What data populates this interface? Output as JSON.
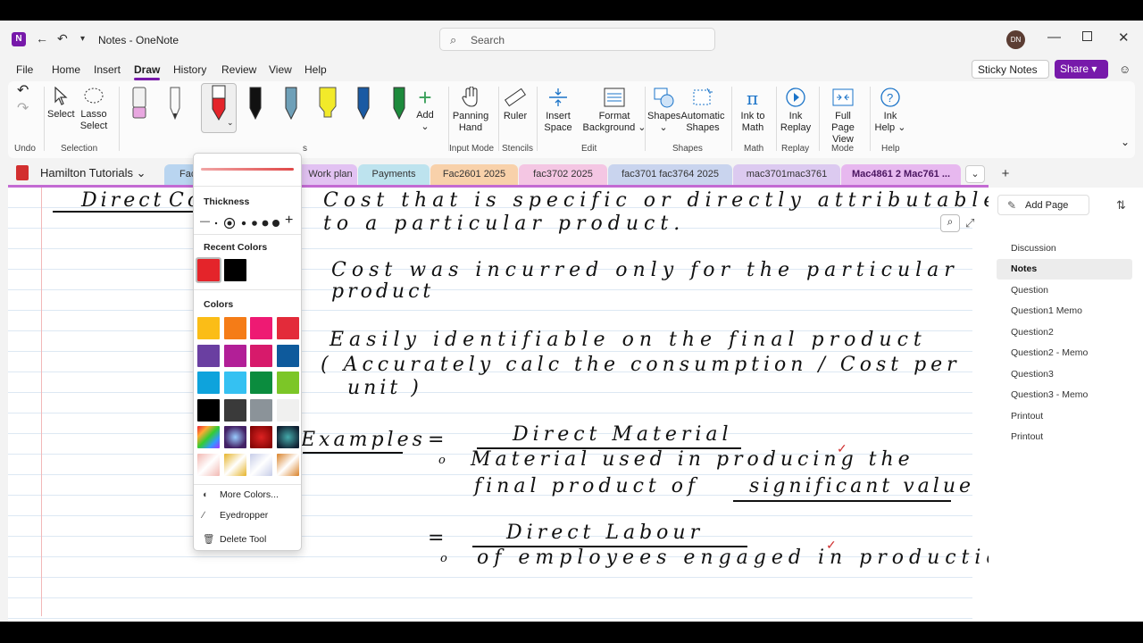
{
  "window": {
    "title": "Notes  -  OneNote",
    "avatar": "DN"
  },
  "search": {
    "placeholder": "Search"
  },
  "menu": {
    "items": [
      "File",
      "Home",
      "Insert",
      "Draw",
      "History",
      "Review",
      "View",
      "Help"
    ],
    "active": "Draw"
  },
  "header_buttons": {
    "sticky_notes": "Sticky Notes",
    "share": "Share"
  },
  "ribbon": {
    "groups": {
      "undo": "Undo",
      "selection": "Selection",
      "input_mode": "Input Mode",
      "stencils": "Stencils",
      "edit": "Edit",
      "shapes": "Shapes",
      "math": "Math",
      "replay": "Replay",
      "mode": "Mode",
      "help": "Help"
    },
    "select": "Select",
    "lasso_1": "Lasso",
    "lasso_2": "Select",
    "add": "Add",
    "panning_1": "Panning",
    "panning_2": "Hand",
    "ruler": "Ruler",
    "insert_space_1": "Insert",
    "insert_space_2": "Space",
    "format_bg_1": "Format",
    "format_bg_2": "Background",
    "shapes": "Shapes",
    "auto_shapes_1": "Automatic",
    "auto_shapes_2": "Shapes",
    "ink_math_1": "Ink to",
    "ink_math_2": "Math",
    "ink_replay_1": "Ink",
    "ink_replay_2": "Replay",
    "full_page_1": "Full Page",
    "full_page_2": "View",
    "ink_help_1": "Ink",
    "ink_help_2": "Help",
    "partial_label": "s"
  },
  "notebook": {
    "name": "Hamilton Tutorials"
  },
  "sections": [
    {
      "label": "Fac",
      "color": "#b9d5f0"
    },
    {
      "label": "Work plan",
      "color": "#e2c2f2"
    },
    {
      "label": "Payments",
      "color": "#bde3ee"
    },
    {
      "label": "Fac2601 2025",
      "color": "#f8d1aa"
    },
    {
      "label": "fac3702 2025",
      "color": "#f4c6e3"
    },
    {
      "label": "fac3701 fac3764 2025",
      "color": "#c9d4ee"
    },
    {
      "label": "mac3701mac3761",
      "color": "#dccaf0"
    },
    {
      "label": "Mac4861 2 Mac761 ...",
      "color": "#e7b8ef"
    }
  ],
  "pages": {
    "add_page": "Add Page",
    "items": [
      "Discussion",
      "Notes",
      "Question",
      "Question1 Memo",
      "Question2",
      "Question2 - Memo",
      "Question3",
      "Question3 - Memo",
      "Printout",
      "Printout"
    ],
    "active": "Notes"
  },
  "pen_popup": {
    "thickness": "Thickness",
    "recent_colors": "Recent Colors",
    "colors": "Colors",
    "more_colors": "More Colors...",
    "eyedropper": "Eyedropper",
    "delete_tool": "Delete Tool",
    "minus": "—",
    "plus": "+",
    "recent": [
      "#e4242a",
      "#000000"
    ],
    "palette": [
      "#fbbd17",
      "#f57c17",
      "#ee1a73",
      "#e32b3a",
      "#6a3fa1",
      "#b21f97",
      "#d71a6b",
      "#0e5a9c",
      "#0ea3dc",
      "#35c1f2",
      "#0b8c3e",
      "#7cc627",
      "#000000",
      "#3a3a3a",
      "#8b9399",
      "#f0f0ef",
      "#e0c050",
      "#7b6ad9",
      "#a00c1c",
      "#1d6b73",
      "#f2b8b2",
      "#e6b42a",
      "#c7cde8",
      "#d9822a"
    ]
  },
  "notes": {
    "l1": "Direct",
    "l1b": "Co",
    "l2": "Cost   that   is   specific   or   directly   attributable",
    "l3": "to   a   particular   product.",
    "l4": "Cost   was   incurred   only   for   the   particular",
    "l5": "product",
    "l6": "Easily   identifiable   on   the   final   product",
    "l7": "( Accurately   calc   the   consumption / Cost   per",
    "l8": "unit )",
    "l9": "Examples",
    "l10": "Direct   Material",
    "l11": "Material   used   in   producing   the",
    "l12": "final   product   of",
    "l13": "significant   value",
    "l14": "Direct   Labour",
    "l15": "of   employees   engaged   in   production",
    "eq": "=",
    "bullet": "o",
    "check": "✓"
  }
}
